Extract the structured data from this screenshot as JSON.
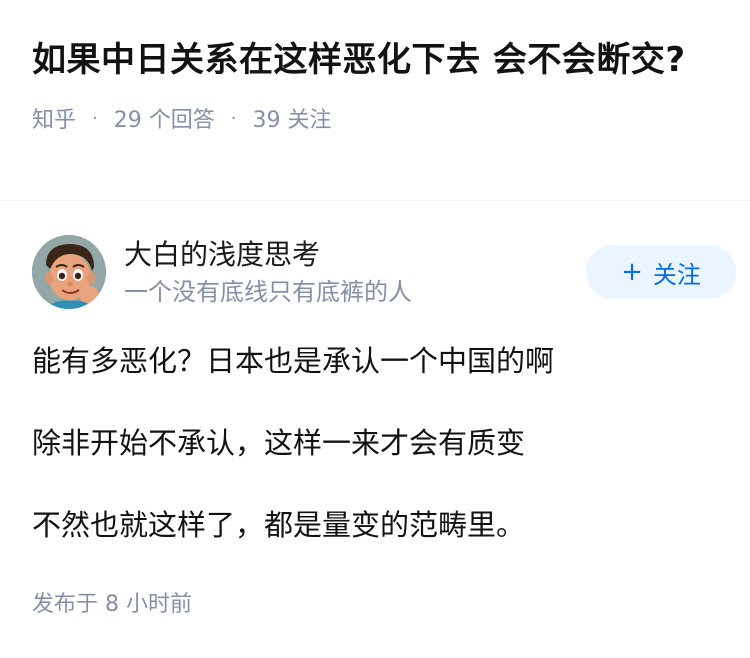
{
  "question": {
    "title": "如果中日关系在这样恶化下去 会不会断交?",
    "source": "知乎",
    "answers_count": "29",
    "answers_label": "个回答",
    "followers_count": "39",
    "followers_label": "关注"
  },
  "answer": {
    "author_name": "大白的浅度思考",
    "author_bio": "一个没有底线只有底裤的人",
    "follow_icon": "+",
    "follow_label": "关注",
    "paragraphs": [
      "能有多恶化？日本也是承认一个中国的啊",
      "除非开始不承认，这样一来才会有质变",
      "不然也就这样了，都是量变的范畴里。"
    ],
    "published_prefix": "发布于",
    "published_time": "8 小时前"
  },
  "colors": {
    "accent": "#056de8",
    "follow_bg": "#ebf5ff",
    "meta_gray": "#8590a6",
    "text": "#121212"
  }
}
